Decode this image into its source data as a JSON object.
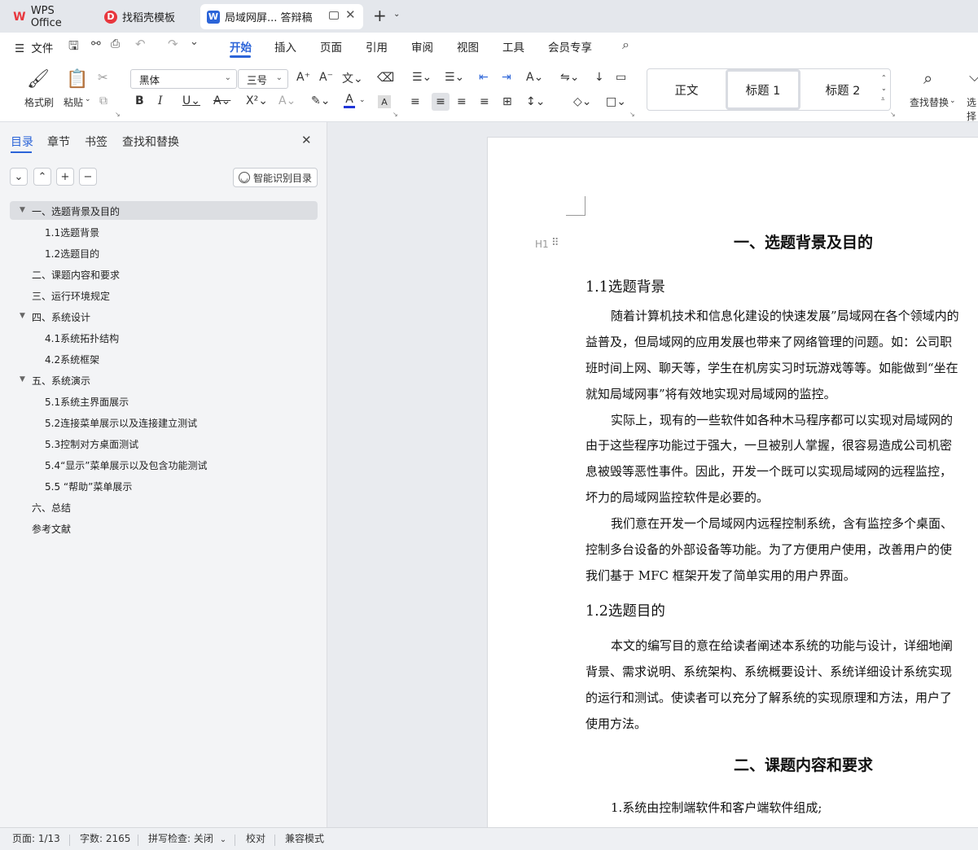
{
  "tabs": [
    {
      "label": "WPS Office",
      "icon": "wps-logo-icon"
    },
    {
      "label": "找稻壳模板",
      "icon": "docer-icon"
    },
    {
      "label": "局域网屏... 答辩稿",
      "icon": "writer-doc-icon"
    }
  ],
  "menubar": {
    "file": "文件",
    "items": [
      "开始",
      "插入",
      "页面",
      "引用",
      "审阅",
      "视图",
      "工具",
      "会员专享"
    ],
    "active": "开始"
  },
  "ribbon": {
    "format_painter": "格式刷",
    "paste": "粘贴",
    "font_name": "黑体",
    "font_size": "三号",
    "styles": [
      "正文",
      "标题  1",
      "标题  2"
    ],
    "find_replace": "查找替换",
    "select": "选择"
  },
  "nav": {
    "tabs": [
      "目录",
      "章节",
      "书签",
      "查找和替换"
    ],
    "active_tab": "目录",
    "smart_toc": "智能识别目录",
    "toc": [
      {
        "label": "一、选题背景及目的",
        "level": 1,
        "expanded": true,
        "selected": true
      },
      {
        "label": "1.1选题背景",
        "level": 2
      },
      {
        "label": "1.2选题目的",
        "level": 2
      },
      {
        "label": "二、课题内容和要求",
        "level": 1
      },
      {
        "label": "三、运行环境规定",
        "level": 1
      },
      {
        "label": "四、系统设计",
        "level": 1,
        "expanded": true
      },
      {
        "label": "4.1系统拓扑结构",
        "level": 2
      },
      {
        "label": "4.2系统框架",
        "level": 2
      },
      {
        "label": "五、系统演示",
        "level": 1,
        "expanded": true
      },
      {
        "label": "5.1系统主界面展示",
        "level": 2
      },
      {
        "label": "5.2连接菜单展示以及连接建立测试",
        "level": 2
      },
      {
        "label": "5.3控制对方桌面测试",
        "level": 2
      },
      {
        "label": "5.4“显示”菜单展示以及包含功能测试",
        "level": 2
      },
      {
        "label": "5.5 “帮助”菜单展示",
        "level": 2
      },
      {
        "label": "六、总结",
        "level": 1
      },
      {
        "label": "参考文献",
        "level": 1
      }
    ]
  },
  "document": {
    "heading_marker": "H1",
    "h1_a": "一、选题背景及目的",
    "h2_a": "1.1选题背景",
    "p1": [
      "随着计算机技术和信息化建设的快速发展”局域网在各个领域内的",
      "益普及，但局域网的应用发展也带来了网络管理的问题。如：公司职",
      "班时间上网、聊天等，学生在机房实习时玩游戏等等。如能做到“坐在",
      "就知局域网事”将有效地实现对局域网的监控。"
    ],
    "p2": [
      "实际上，现有的一些软件如各种木马程序都可以实现对局域网的",
      "由于这些程序功能过于强大，一旦被别人掌握，很容易造成公司机密",
      "息被毁等恶性事件。因此，开发一个既可以实现局域网的远程监控，",
      "坏力的局域网监控软件是必要的。"
    ],
    "p3": [
      "我们意在开发一个局域网内远程控制系统，含有监控多个桌面、",
      "控制多台设备的外部设备等功能。为了方便用户使用，改善用户的使",
      "我们基于 MFC 框架开发了简单实用的用户界面。"
    ],
    "h2_b": "1.2选题目的",
    "p4": [
      "本文的编写目的意在给读者阐述本系统的功能与设计，详细地阐",
      "背景、需求说明、系统架构、系统概要设计、系统详细设计系统实现",
      "的运行和测试。使读者可以充分了解系统的实现原理和方法，用户了",
      "使用方法。"
    ],
    "h1_b": "二、课题内容和要求",
    "p5": "1.系统由控制端软件和客户端软件组成;"
  },
  "status": {
    "page": "页面: 1/13",
    "words": "字数: 2165",
    "spell": "拼写检查: 关闭",
    "proof": "校对",
    "compat": "兼容模式"
  },
  "colors": {
    "accent": "#2b64d8",
    "wps_red": "#e8363d"
  }
}
